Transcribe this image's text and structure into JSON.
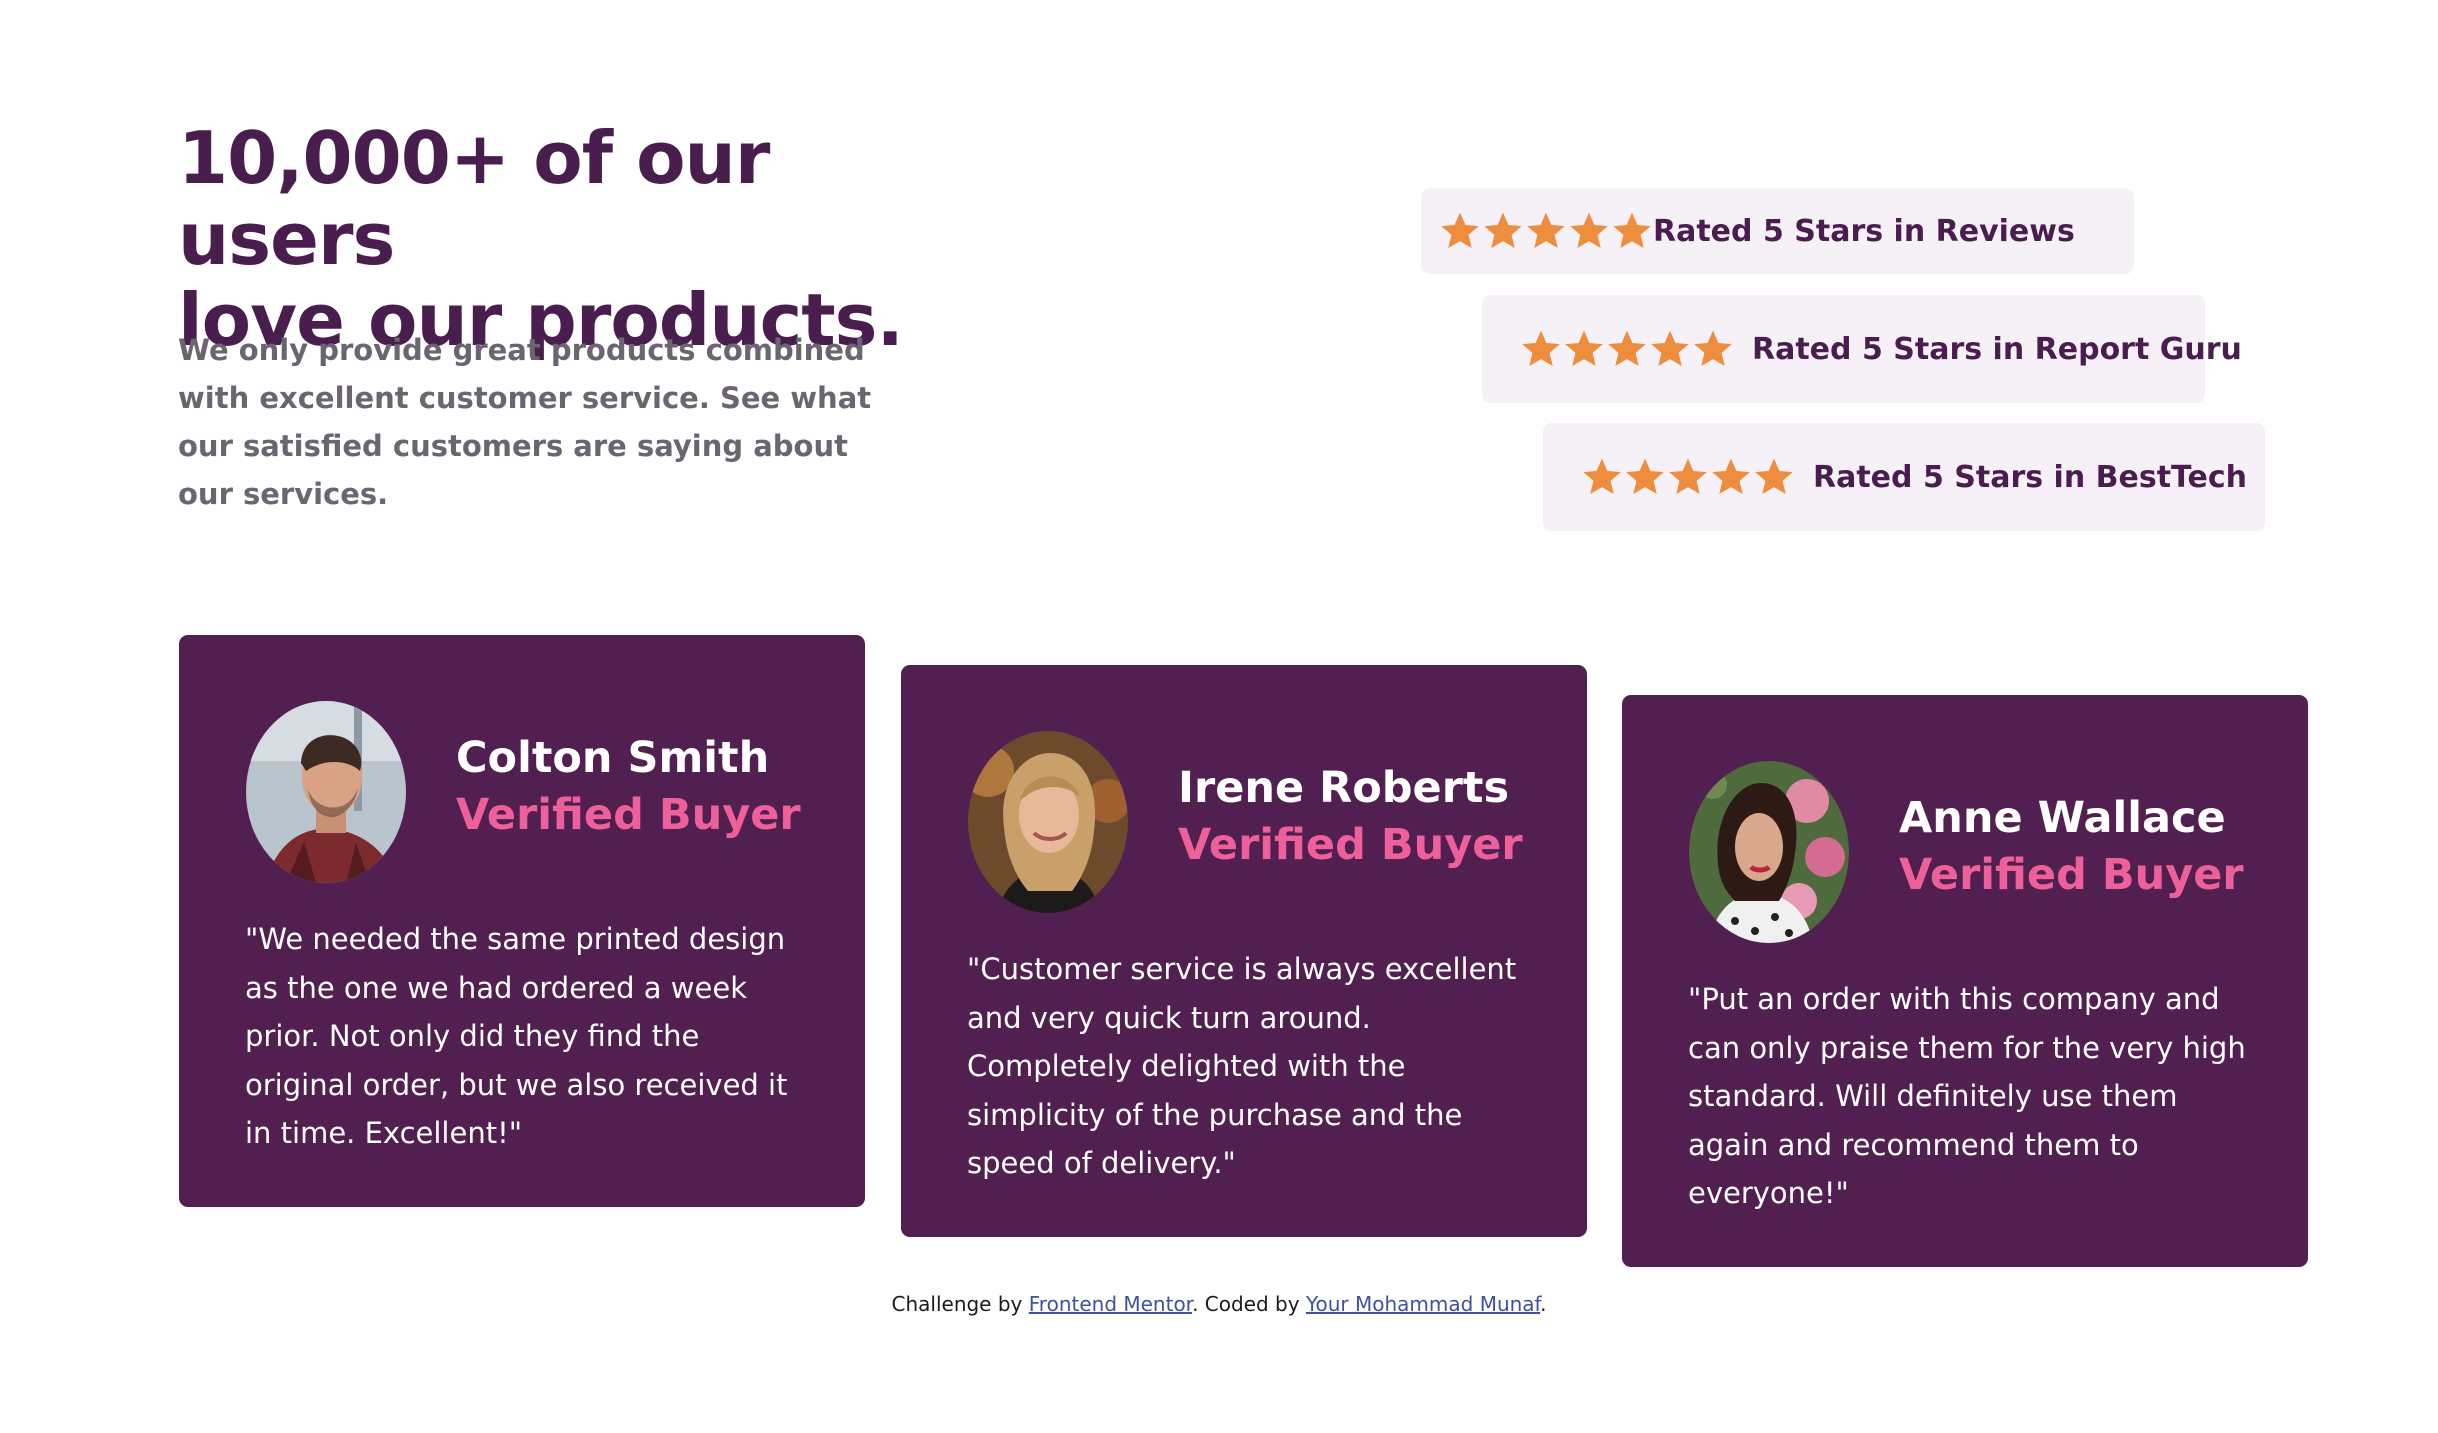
{
  "header": {
    "headline_line1": "10,000+ of our users",
    "headline_line2": "love our products.",
    "intro": "We only provide great products combined with excellent customer service. See what our satisfied customers are saying about our services."
  },
  "ratings": [
    {
      "stars": 5,
      "label": "Rated 5 Stars in Reviews"
    },
    {
      "stars": 5,
      "label": "Rated 5 Stars in Report Guru"
    },
    {
      "stars": 5,
      "label": "Rated 5 Stars in BestTech"
    }
  ],
  "testimonials": [
    {
      "name": "Colton Smith",
      "role": "Verified Buyer",
      "quote": "\"We needed the same printed design as the one we had ordered a week prior. Not only did they find the original order, but we also received it in time. Excellent!\""
    },
    {
      "name": "Irene Roberts",
      "role": "Verified Buyer",
      "quote": "\"Customer service is always excellent and very quick turn around. Completely delighted with the simplicity of the purchase and the speed of delivery.\""
    },
    {
      "name": "Anne Wallace",
      "role": "Verified Buyer",
      "quote": "\"Put an order with this company and can only praise them for the very high standard. Will definitely use them again and recommend them to everyone!\""
    }
  ],
  "footer": {
    "prefix": "Challenge by ",
    "link1": "Frontend Mentor",
    "middle": ". Coded by ",
    "link2": "Your Mohammad Munaf",
    "suffix": "."
  },
  "colors": {
    "primary": "#4a1d4f",
    "card_bg": "#521f51",
    "accent_pink": "#ee609a",
    "star": "#ee8d3d",
    "rating_bg": "#f6f0f7",
    "body_text": "#6b6570"
  }
}
